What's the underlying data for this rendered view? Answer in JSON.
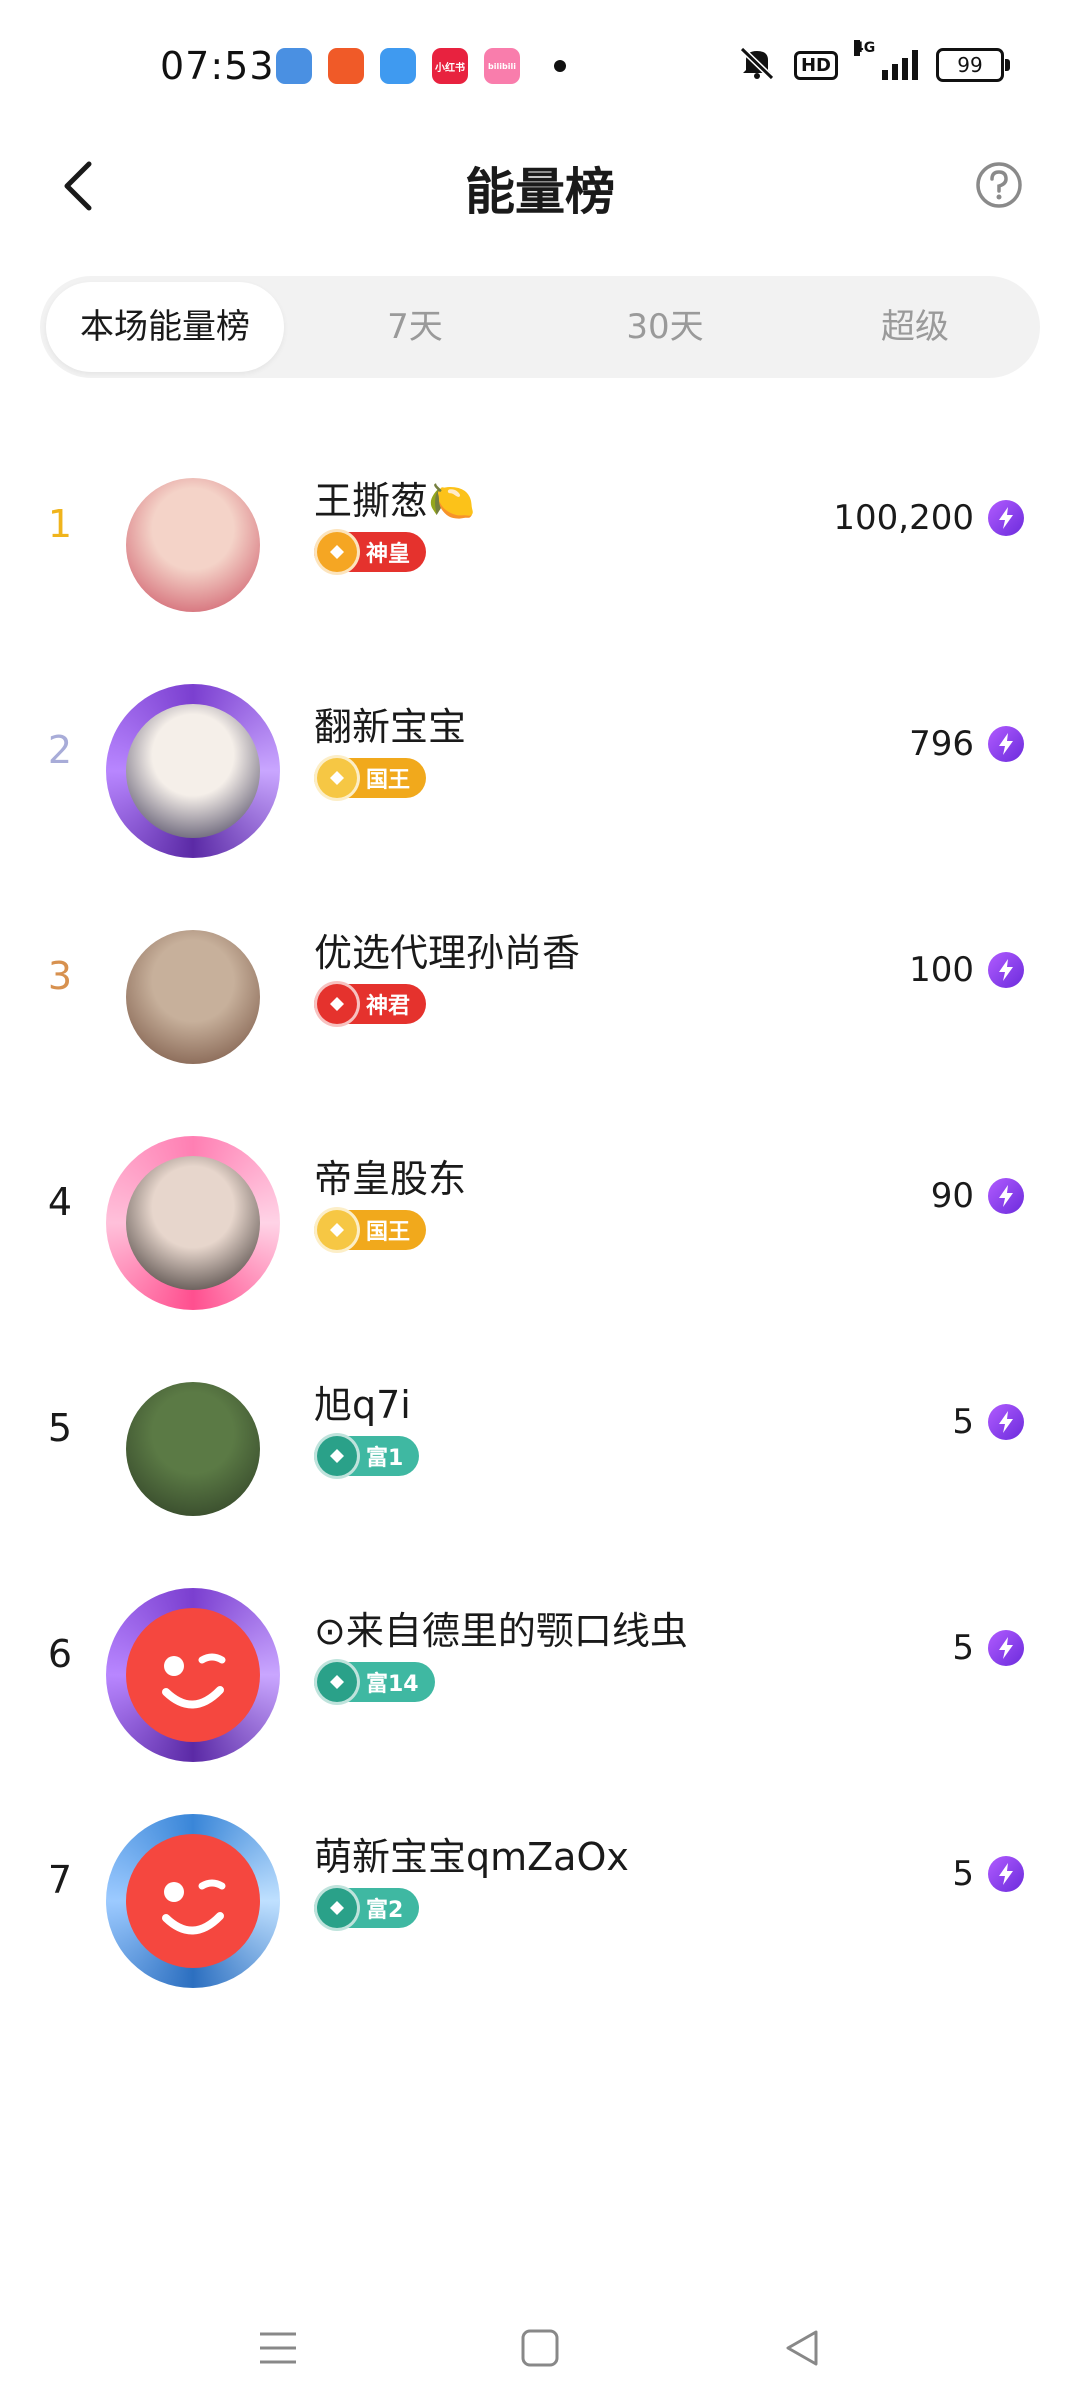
{
  "status_bar": {
    "time": "07:53",
    "apps": [
      {
        "icon": "feather-app-icon",
        "color": "#4a90e2",
        "label": ""
      },
      {
        "icon": "video-app-icon",
        "color": "#f05a28",
        "label": ""
      },
      {
        "icon": "weather-app-icon",
        "color": "#3f9af0",
        "label": ""
      },
      {
        "icon": "xiaohongshu-app-icon",
        "color": "#e8223f",
        "label": "小红书"
      },
      {
        "icon": "bilibili-app-icon",
        "color": "#f97dac",
        "label": "bilibili"
      }
    ],
    "hd_label": "HD",
    "network_label": "4G",
    "battery": "99"
  },
  "header": {
    "title": "能量榜"
  },
  "tabs": [
    {
      "label": "本场能量榜",
      "active": true
    },
    {
      "label": "7天",
      "active": false
    },
    {
      "label": "30天",
      "active": false
    },
    {
      "label": "超级",
      "active": false
    }
  ],
  "ranking": [
    {
      "rank": "1",
      "name": "王撕葱🍋",
      "badge": "神皇",
      "score": "100,200",
      "rank_color": "#f0b41c",
      "badge_color": "#e5322d",
      "badge_icon_color": "#f5a623",
      "frame": "none",
      "avatar_colors": [
        "#f4d3c8",
        "#c9485b"
      ]
    },
    {
      "rank": "2",
      "name": "翻新宝宝",
      "badge": "国王",
      "score": "796",
      "rank_color": "#a8acd8",
      "badge_color": "#f1a91c",
      "badge_icon_color": "#f6c744",
      "frame": "purple",
      "avatar_colors": [
        "#f5efe9",
        "#2f2a4a"
      ]
    },
    {
      "rank": "3",
      "name": "优选代理孙尚香",
      "badge": "神君",
      "score": "100",
      "rank_color": "#d7914f",
      "badge_color": "#e5322d",
      "badge_icon_color": "#e5322d",
      "frame": "none",
      "avatar_colors": [
        "#c7b09b",
        "#6f4b3a"
      ]
    },
    {
      "rank": "4",
      "name": "帝皇股东",
      "badge": "国王",
      "score": "90",
      "rank_color": "#1a1a1a",
      "badge_color": "#f1a91c",
      "badge_icon_color": "#f6c744",
      "frame": "pink",
      "avatar_colors": [
        "#e7d6cc",
        "#2a2322"
      ]
    },
    {
      "rank": "5",
      "name": "旭q7i",
      "badge": "富1",
      "score": "5",
      "rank_color": "#1a1a1a",
      "badge_color": "#3fb8a2",
      "badge_icon_color": "#2aa189",
      "frame": "none",
      "avatar_colors": [
        "#5b7a45",
        "#2b3a23"
      ]
    },
    {
      "rank": "6",
      "name": "⊙来自德里的颚口线虫",
      "badge": "富14",
      "score": "5",
      "rank_color": "#1a1a1a",
      "badge_color": "#3fb8a2",
      "badge_icon_color": "#2aa189",
      "frame": "purple",
      "avatar_colors": [
        "#f5473f",
        "#e23a32"
      ]
    },
    {
      "rank": "7",
      "name": "萌新宝宝qmZaOx",
      "badge": "富2",
      "score": "5",
      "rank_color": "#1a1a1a",
      "badge_color": "#3fb8a2",
      "badge_icon_color": "#2aa189",
      "frame": "blue",
      "avatar_colors": [
        "#f5473f",
        "#e23a32"
      ]
    }
  ]
}
